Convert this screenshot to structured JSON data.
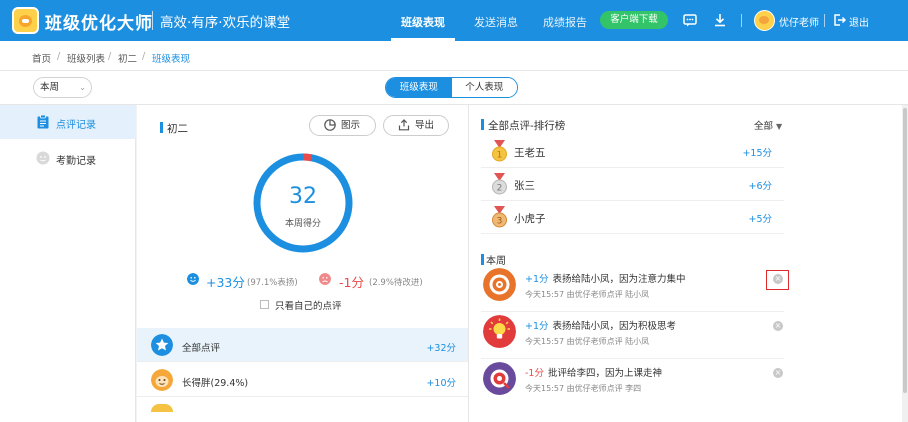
{
  "header": {
    "brand": "班级优化大师",
    "slogan": "高效·有序·欢乐的课堂",
    "nav": [
      "班级表现",
      "发送消息",
      "成绩报告"
    ],
    "download_button": "客户端下载",
    "user_name": "优仔老师",
    "logout": "退出",
    "icons": [
      "message-icon",
      "download-icon",
      "logout-icon"
    ],
    "brand_color": "#1c8fe0"
  },
  "breadcrumb": [
    "首页",
    "班级列表",
    "初二",
    "班级表现"
  ],
  "toolbar": {
    "week_select": "本周",
    "tabs": [
      "班级表现",
      "个人表现"
    ]
  },
  "sidebar": {
    "items": [
      {
        "label": "点评记录",
        "icon": "clipboard-icon",
        "active": true
      },
      {
        "label": "考勤记录",
        "icon": "attendance-icon",
        "active": false
      }
    ]
  },
  "summary": {
    "class_name": "初二",
    "chart_button": "图示",
    "export_button": "导出",
    "score": "32",
    "score_label": "本周得分",
    "negative_fraction": 0.029,
    "positive": {
      "value": "+33分",
      "note": "(97.1%表扬)"
    },
    "negative": {
      "value": "-1分",
      "note": "(2.9%待改进)"
    },
    "own_only_label": "只看自己的点评",
    "list": [
      {
        "label": "全部点评",
        "value": "+32分",
        "icon": "star-icon"
      },
      {
        "label": "长得胖(29.4%)",
        "value": "+10分",
        "icon": "monkey-avatar-icon"
      }
    ]
  },
  "ranking": {
    "title": "全部点评-排行榜",
    "filter": "全部",
    "items": [
      {
        "rank": "1",
        "name": "王老五",
        "points": "+15分"
      },
      {
        "rank": "2",
        "name": "张三",
        "points": "+6分"
      },
      {
        "rank": "3",
        "name": "小虎子",
        "points": "+5分"
      }
    ]
  },
  "records": {
    "title": "本周",
    "items": [
      {
        "points": "+1分",
        "text": "表扬给陆小凤，因为注意力集中",
        "meta": "今天15:57 由优仔老师点评 陆小凤",
        "color": "#e8742c",
        "icon": "target-icon"
      },
      {
        "points": "+1分",
        "text": "表扬给陆小凤，因为积极思考",
        "meta": "今天15:57 由优仔老师点评 陆小凤",
        "color": "#e23b3b",
        "icon": "lightbulb-icon"
      },
      {
        "points": "-1分",
        "text": "批评给李四，因为上课走神",
        "meta": "今天15:57 由优仔老师点评 李四",
        "color": "#6a4a9c",
        "icon": "distracted-icon"
      }
    ]
  }
}
